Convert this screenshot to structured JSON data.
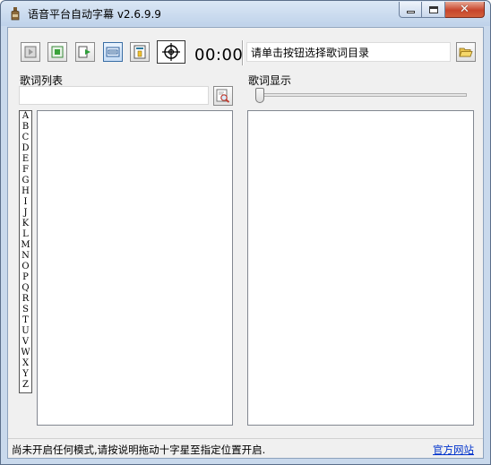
{
  "window": {
    "title": "语音平台自动字幕 v2.6.9.9",
    "app_icon": "bottle-icon"
  },
  "caption_buttons": {
    "minimize_icon": "minimize-icon",
    "maximize_icon": "maximize-icon",
    "close_glyph": "✕"
  },
  "toolbar": {
    "buttons": [
      {
        "name": "play-button",
        "icon": "play-icon"
      },
      {
        "name": "stop-button",
        "icon": "stop-icon"
      },
      {
        "name": "resume-button",
        "icon": "resume-icon"
      },
      {
        "name": "screen-mode-button",
        "icon": "screen-icon"
      },
      {
        "name": "text-mode-button",
        "icon": "text-frame-icon"
      }
    ],
    "crosshair_icon": "crosshair-icon",
    "time": "00:00",
    "directory_prompt": "请单击按钮选择歌词目录",
    "folder_icon": "folder-open-icon"
  },
  "left_panel": {
    "title": "歌词列表",
    "search_value": "",
    "search_icon": "search-icon",
    "alphabet": [
      "A",
      "B",
      "C",
      "D",
      "E",
      "F",
      "G",
      "H",
      "I",
      "J",
      "K",
      "L",
      "M",
      "N",
      "O",
      "P",
      "Q",
      "R",
      "S",
      "T",
      "U",
      "V",
      "W",
      "X",
      "Y",
      "Z"
    ],
    "items": []
  },
  "right_panel": {
    "title": "歌词显示",
    "slider_value": 0,
    "lyrics": ""
  },
  "statusbar": {
    "message": "尚未开启任何模式,请按说明拖动十字星至指定位置开启.",
    "link": "官方网站"
  },
  "colors": {
    "titlebar": "#bfd2ea",
    "close_button": "#c7452b",
    "link": "#0033cc",
    "client_bg": "#f0f0f0"
  }
}
